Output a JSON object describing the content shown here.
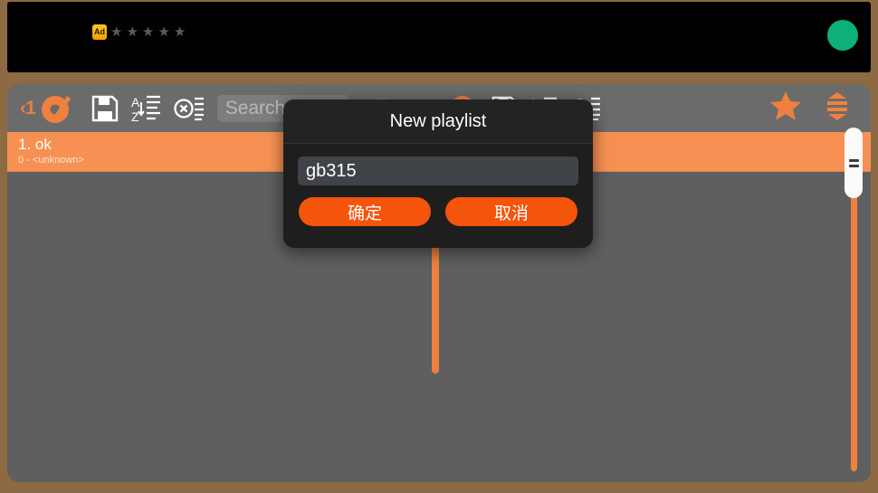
{
  "ad_banner": {
    "badge_label": "Ad",
    "star_glyph": "★",
    "star_count": 5,
    "badge_color": "#f2a007",
    "star_color": "#5a5a5a",
    "dot_color": "#0cb07a",
    "background": "#000000"
  },
  "toolbar": {
    "back_label": "‹1",
    "logo_icon": "vinyl-record-icon",
    "save_icon": "floppy-disk-icon",
    "sort_icon": "sort-a-z-icon",
    "clear_icon": "clear-list-icon",
    "search": {
      "placeholder": "Search",
      "value": ""
    },
    "hidden_icons": [
      "add-to-playlist-icon",
      "shuffle-icon",
      "vinyl-record-icon",
      "save-icon",
      "sort-a-z-icon"
    ],
    "clear_right_icon": "clear-list-icon",
    "favorites_icon": "star-icon",
    "equalizer_icon": "equalizer-icon",
    "accent_color": "#f0803f",
    "background": "#6b6b6b"
  },
  "playlist": {
    "rows": [
      {
        "title": "1. ok",
        "subtitle": "0 - <unknown>",
        "selected": true
      }
    ],
    "row_color": "#f79153",
    "panel_color": "#5f5f5f"
  },
  "scrollbar": {
    "track_color": "#f0803f",
    "thumb_color": "#fbfbfb",
    "grip_count": 2
  },
  "dialog": {
    "title": "New playlist",
    "input_value": "gb315",
    "input_placeholder": "",
    "confirm_label": "确定",
    "cancel_label": "取消",
    "button_color": "#f4540c",
    "background": "#1e1e1e"
  }
}
